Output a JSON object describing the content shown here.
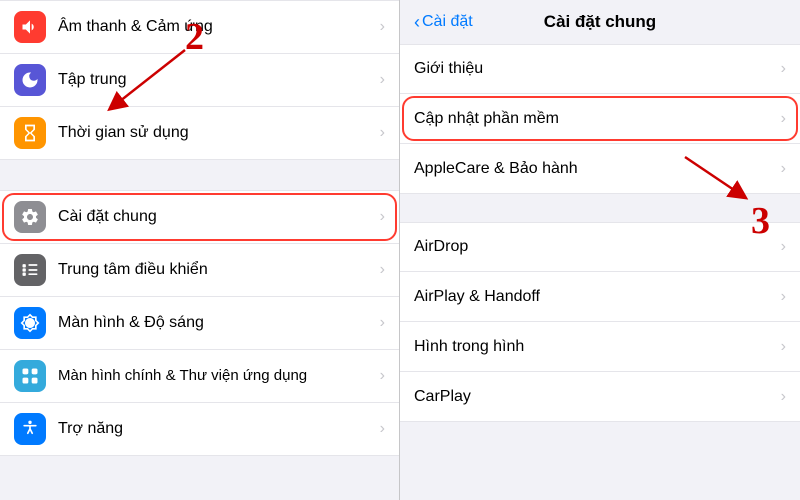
{
  "left": {
    "items_top": [
      {
        "id": "am-thanh",
        "label": "Âm thanh & Cảm ứng",
        "icon_color": "#ff3b30",
        "icon": "sound"
      },
      {
        "id": "tap-trung",
        "label": "Tập trung",
        "icon_color": "#5856d6",
        "icon": "moon"
      },
      {
        "id": "thoi-gian",
        "label": "Thời gian sử dụng",
        "icon_color": "#ff9500",
        "icon": "hourglass"
      }
    ],
    "items_bottom": [
      {
        "id": "cai-dat-chung",
        "label": "Cài đặt chung",
        "icon_color": "#8e8e93",
        "icon": "gear",
        "highlighted": true
      },
      {
        "id": "trung-tam",
        "label": "Trung tâm điều khiển",
        "icon_color": "#636366",
        "icon": "controls"
      },
      {
        "id": "man-hinh",
        "label": "Màn hình & Độ sáng",
        "icon_color": "#007aff",
        "icon": "brightness"
      },
      {
        "id": "man-hinh-chinh",
        "label": "Màn hình chính & Thư viện ứng dụng",
        "icon_color": "#34aadc",
        "icon": "apps",
        "two_line": true
      },
      {
        "id": "tro-nang",
        "label": "Trợ năng",
        "icon_color": "#007aff",
        "icon": "accessibility"
      }
    ],
    "annotation": "2"
  },
  "right": {
    "back_label": "Cài đặt",
    "title": "Cài đặt chung",
    "items_top": [
      {
        "id": "gioi-thieu",
        "label": "Giới thiệu",
        "highlighted": false
      },
      {
        "id": "cap-nhat",
        "label": "Cập nhật phần mềm",
        "highlighted": true
      },
      {
        "id": "applecare",
        "label": "AppleCare & Bảo hành",
        "highlighted": false
      }
    ],
    "items_bottom": [
      {
        "id": "airdrop",
        "label": "AirDrop",
        "highlighted": false
      },
      {
        "id": "airplay",
        "label": "AirPlay & Handoff",
        "highlighted": false
      },
      {
        "id": "hinh-trong-hinh",
        "label": "Hình trong hình",
        "highlighted": false
      },
      {
        "id": "carplay",
        "label": "CarPlay",
        "highlighted": false
      }
    ],
    "annotation": "3"
  }
}
